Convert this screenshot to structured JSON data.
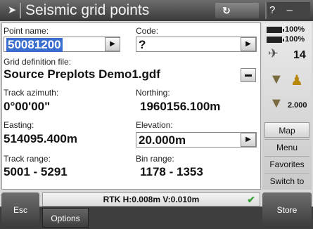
{
  "titlebar": {
    "app_icon": "cursor-arrow-icon",
    "title": "Seismic grid points",
    "tb_icon_1": "↻",
    "tb_icon_2": "⊘",
    "help": "?",
    "minimize": "–",
    "close": "×"
  },
  "form": {
    "point_name": {
      "label": "Point name:",
      "value": "50081200"
    },
    "code": {
      "label": "Code:",
      "value": "?"
    },
    "grid_def": {
      "label": "Grid definition file:",
      "value": "Source Preplots Demo1.gdf"
    },
    "track_azimuth": {
      "label": "Track azimuth:",
      "value": "0°00'00\""
    },
    "northing": {
      "label": "Northing:",
      "value": "1960156.100m"
    },
    "easting": {
      "label": "Easting:",
      "value": "514095.400m"
    },
    "elevation": {
      "label": "Elevation:",
      "value": "20.000m"
    },
    "track_range": {
      "label": "Track range:",
      "value": "5001 - 5291"
    },
    "bin_range": {
      "label": "Bin range:",
      "value": "1178 - 1353"
    }
  },
  "status": {
    "text": "RTK H:0.008m V:0.010m",
    "check": "✔"
  },
  "side": {
    "battery_1": "100%",
    "battery_2": "100%",
    "satellites": "14",
    "antenna_height": "2.000",
    "buttons": [
      "Map",
      "Menu",
      "Favorites",
      "Switch to"
    ]
  },
  "buttons": {
    "esc": "Esc",
    "options": "Options",
    "store": "Store"
  },
  "colors": {
    "selection": "#3a6fd0",
    "check": "#3aa03a"
  }
}
